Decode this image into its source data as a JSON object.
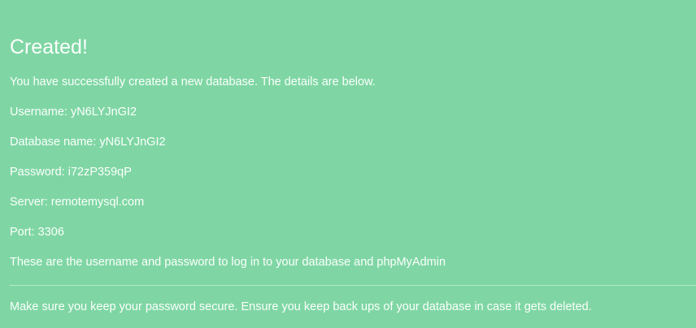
{
  "title": "Created!",
  "intro": "You have successfully created a new database. The details are below.",
  "details": [
    "Username: yN6LYJnGI2",
    "Database name: yN6LYJnGI2",
    "Password: i72zP359qP",
    "Server: remotemysql.com",
    "Port: 3306"
  ],
  "login_note": "These are the username and password to log in to your database and phpMyAdmin",
  "security_note": "Make sure you keep your password secure. Ensure you keep back ups of your database in case it gets deleted.",
  "colors": {
    "background": "#7fd6a4",
    "text": "#fbfffc"
  }
}
